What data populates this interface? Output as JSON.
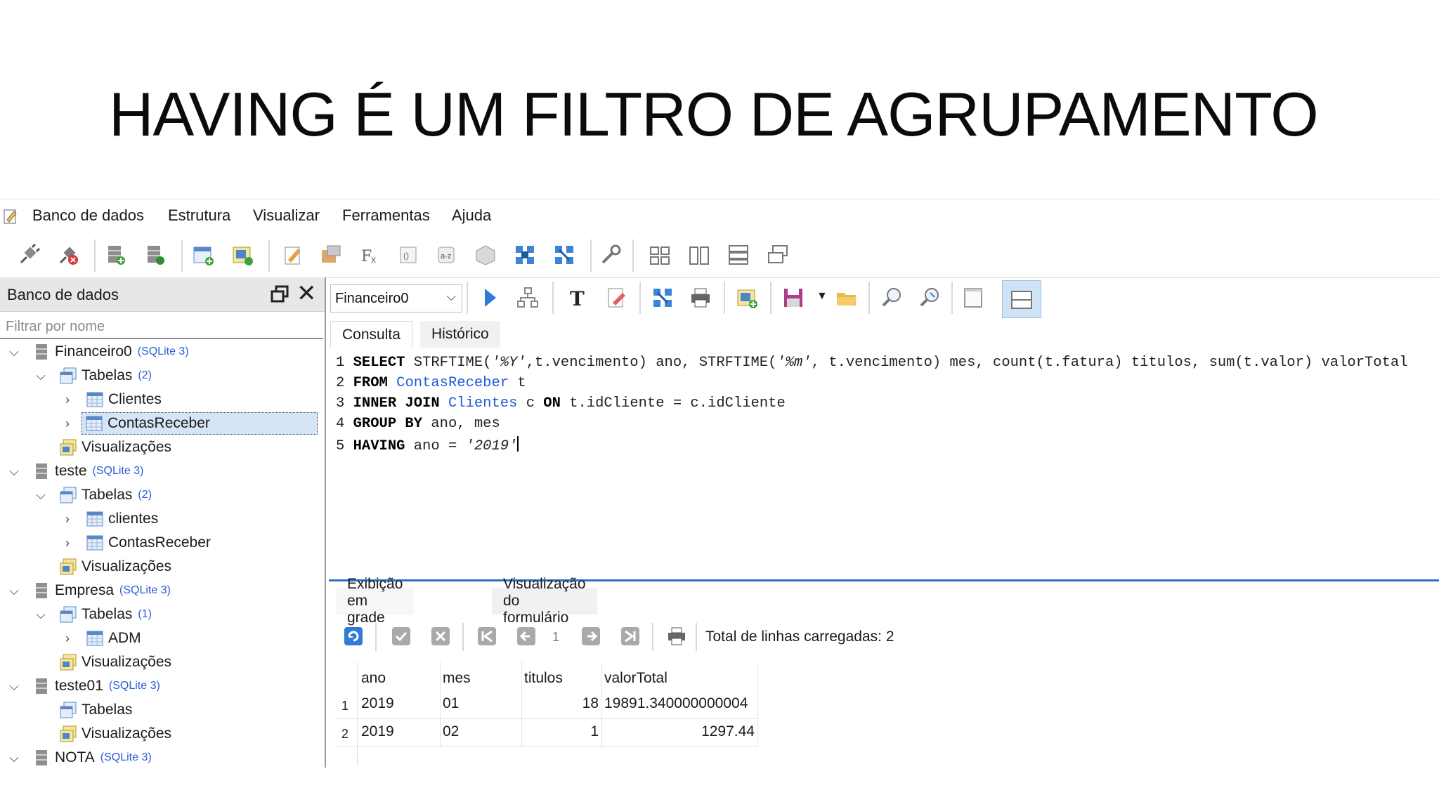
{
  "slide": {
    "title": "HAVING É UM FILTRO DE AGRUPAMENTO"
  },
  "menu": {
    "items": [
      "Banco de dados",
      "Estrutura",
      "Visualizar",
      "Ferramentas",
      "Ajuda"
    ]
  },
  "left_panel": {
    "title": "Banco de dados",
    "filter_placeholder": "Filtrar por nome",
    "tree": {
      "db1": {
        "name": "Financeiro0",
        "tag": "(SQLite 3)"
      },
      "db1_tables": {
        "name": "Tabelas",
        "tag": "(2)"
      },
      "db1_t1": "Clientes",
      "db1_t2": "ContasReceber",
      "db1_views": "Visualizações",
      "db2": {
        "name": "teste",
        "tag": "(SQLite 3)"
      },
      "db2_tables": {
        "name": "Tabelas",
        "tag": "(2)"
      },
      "db2_t1": "clientes",
      "db2_t2": "ContasReceber",
      "db2_views": "Visualizações",
      "db3": {
        "name": "Empresa",
        "tag": "(SQLite 3)"
      },
      "db3_tables": {
        "name": "Tabelas",
        "tag": "(1)"
      },
      "db3_t1": "ADM",
      "db3_views": "Visualizações",
      "db4": {
        "name": "teste01",
        "tag": "(SQLite 3)"
      },
      "db4_tables": "Tabelas",
      "db4_views": "Visualizações",
      "db5": {
        "name": "NOTA",
        "tag": "(SQLite 3)"
      }
    }
  },
  "editor_toolbar": {
    "database_selected": "Financeiro0"
  },
  "editor_tabs": [
    "Consulta",
    "Histórico"
  ],
  "sql": {
    "line_numbers": [
      "1",
      "2",
      "3",
      "4",
      "5"
    ],
    "l1": {
      "kw1": "SELECT",
      "p1": " STRFTIME(",
      "s1": "'%Y'",
      "p2": ",t.vencimento) ano, STRFTIME(",
      "s2": "'%m'",
      "p3": ", t.vencimento) mes, count(t.fatura) titulos, sum(t.valor) valorTotal"
    },
    "l2": {
      "kw": "FROM",
      "tbl": "ContasReceber",
      "rest": " t"
    },
    "l3": {
      "kw1": "INNER JOIN",
      "tbl": "Clientes",
      "p1": " c ",
      "kw2": "ON",
      "p2": " t.idCliente = c.idCliente"
    },
    "l4": {
      "kw": "GROUP BY",
      "rest": " ano, mes"
    },
    "l5": {
      "kw": "HAVING",
      "rest": " ano = ",
      "str": "'2019'"
    }
  },
  "result_tabs": [
    "Exibição em grade",
    "Visualização do formulário"
  ],
  "result_nav": {
    "page": "1",
    "total_label": "Total de linhas carregadas: 2"
  },
  "grid": {
    "columns": [
      "ano",
      "mes",
      "titulos",
      "valorTotal"
    ],
    "rows": [
      {
        "num": "1",
        "cells": [
          "2019",
          "01",
          "18",
          "19891.340000000004"
        ]
      },
      {
        "num": "2",
        "cells": [
          "2019",
          "02",
          "1",
          "1297.44"
        ]
      }
    ]
  }
}
